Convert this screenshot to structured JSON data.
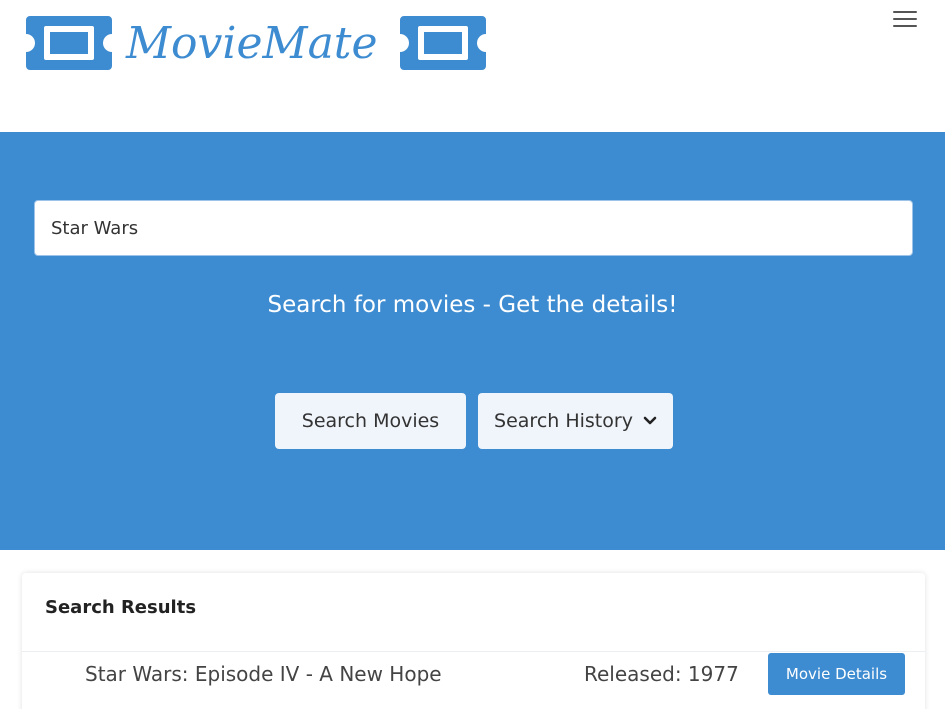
{
  "header": {
    "logo_text": "MovieMate"
  },
  "search": {
    "value": "Star Wars",
    "tagline": "Search for movies - Get the details!",
    "search_button_label": "Search Movies",
    "history_button_label": "Search History"
  },
  "results": {
    "title": "Search Results",
    "items": [
      {
        "title": "Star Wars: Episode IV - A New Hope",
        "released": "Released: 1977",
        "details_label": "Movie Details"
      }
    ]
  },
  "colors": {
    "brand_blue": "#3d8bd0",
    "button_light": "#f0f5fb",
    "text_dark": "#222222"
  },
  "icons": {
    "logo_left": "ticket-icon",
    "logo_right": "ticket-icon",
    "menu": "hamburger-menu-icon",
    "history_dropdown": "chevron-down-icon"
  }
}
